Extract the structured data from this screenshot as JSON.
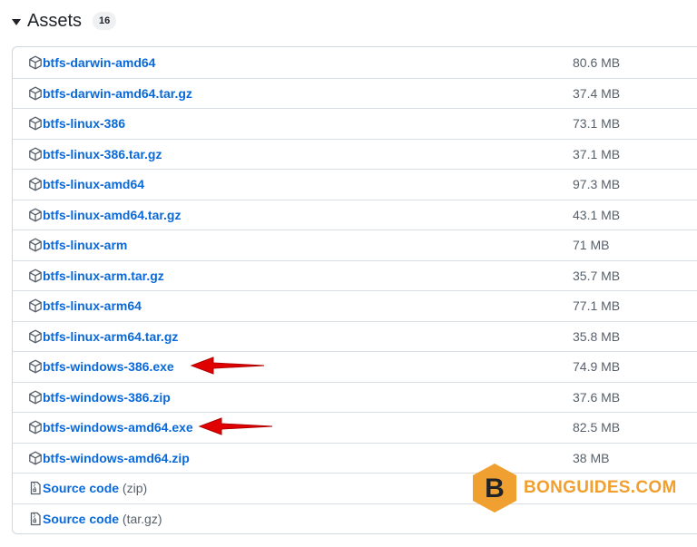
{
  "assets": {
    "title": "Assets",
    "count": "16",
    "items": [
      {
        "name": "btfs-darwin-amd64",
        "size": "80.6 MB",
        "icon": "package-icon"
      },
      {
        "name": "btfs-darwin-amd64.tar.gz",
        "size": "37.4 MB",
        "icon": "package-icon"
      },
      {
        "name": "btfs-linux-386",
        "size": "73.1 MB",
        "icon": "package-icon"
      },
      {
        "name": "btfs-linux-386.tar.gz",
        "size": "37.1 MB",
        "icon": "package-icon"
      },
      {
        "name": "btfs-linux-amd64",
        "size": "97.3 MB",
        "icon": "package-icon"
      },
      {
        "name": "btfs-linux-amd64.tar.gz",
        "size": "43.1 MB",
        "icon": "package-icon"
      },
      {
        "name": "btfs-linux-arm",
        "size": "71 MB",
        "icon": "package-icon"
      },
      {
        "name": "btfs-linux-arm.tar.gz",
        "size": "35.7 MB",
        "icon": "package-icon"
      },
      {
        "name": "btfs-linux-arm64",
        "size": "77.1 MB",
        "icon": "package-icon"
      },
      {
        "name": "btfs-linux-arm64.tar.gz",
        "size": "35.8 MB",
        "icon": "package-icon"
      },
      {
        "name": "btfs-windows-386.exe",
        "size": "74.9 MB",
        "icon": "package-icon"
      },
      {
        "name": "btfs-windows-386.zip",
        "size": "37.6 MB",
        "icon": "package-icon"
      },
      {
        "name": "btfs-windows-amd64.exe",
        "size": "82.5 MB",
        "icon": "package-icon"
      },
      {
        "name": "btfs-windows-amd64.zip",
        "size": "38 MB",
        "icon": "package-icon"
      }
    ],
    "source": [
      {
        "label": "Source code",
        "suffix": "(zip)",
        "icon": "file-zip-icon"
      },
      {
        "label": "Source code",
        "suffix": "(tar.gz)",
        "icon": "file-zip-icon"
      }
    ]
  },
  "watermark": {
    "text": "BONGUIDES.COM",
    "letter": "B"
  },
  "colors": {
    "link": "#0969da",
    "muted": "#57606a",
    "border": "#d0d7de",
    "arrow": "#e00000",
    "brand": "#f0a030"
  }
}
